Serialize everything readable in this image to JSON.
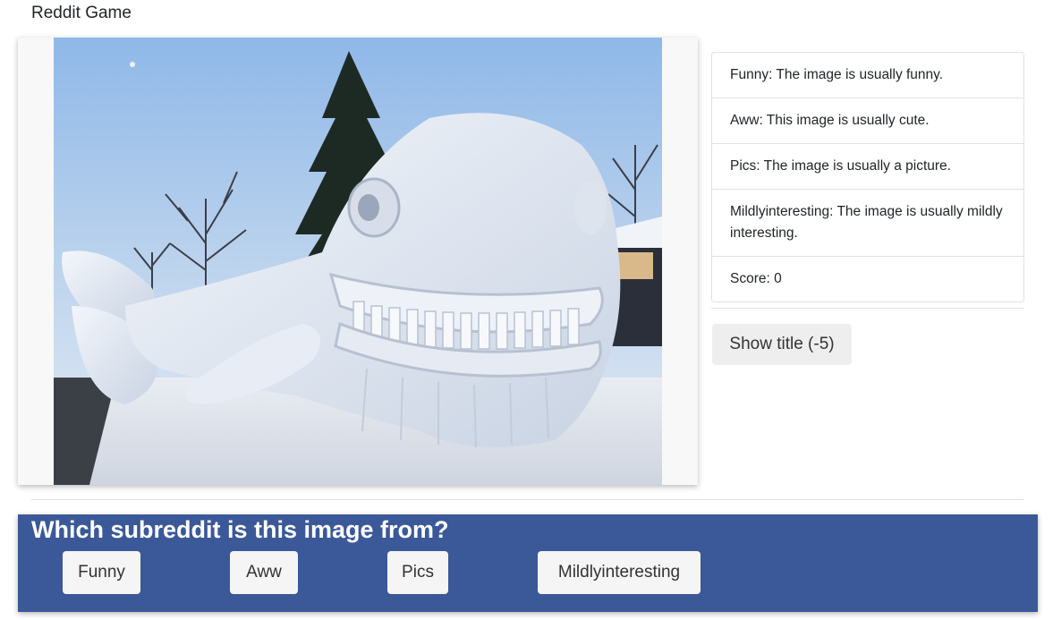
{
  "app": {
    "title": "Reddit Game"
  },
  "hints": [
    {
      "label": "Funny: The image is usually funny."
    },
    {
      "label": "Aww: This image is usually cute."
    },
    {
      "label": "Pics: The image is usually a picture."
    },
    {
      "label": "Mildlyinteresting: The image is usually mildly interesting."
    },
    {
      "label": "Score: 0"
    }
  ],
  "controls": {
    "show_title_label": "Show title (-5)"
  },
  "question": {
    "text": "Which subreddit is this image from?",
    "choices": [
      "Funny",
      "Aww",
      "Pics",
      "Mildlyinteresting"
    ]
  },
  "colors": {
    "panel_bg": "#3b5998",
    "button_bg": "#f5f5f5",
    "border": "#dee2e6"
  }
}
